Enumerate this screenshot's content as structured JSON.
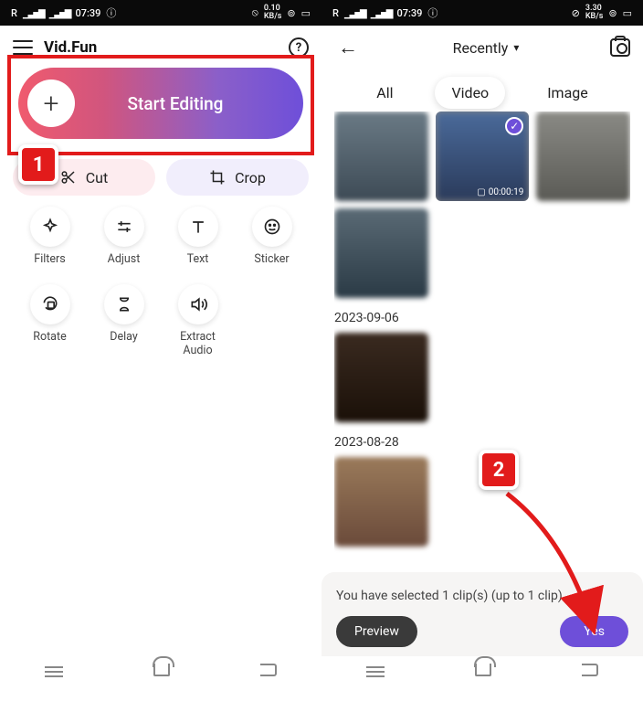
{
  "status": {
    "carrier": "R",
    "time": "07:39",
    "net_speed": "0.10",
    "net_unit": "KB/s",
    "battery": "100"
  },
  "appbar": {
    "title": "Vid.Fun"
  },
  "start": {
    "label": "Start Editing"
  },
  "pills": {
    "cut": "Cut",
    "crop": "Crop"
  },
  "tools": {
    "filters": "Filters",
    "adjust": "Adjust",
    "text": "Text",
    "sticker": "Sticker",
    "rotate": "Rotate",
    "delay": "Delay",
    "extract": "Extract\nAudio"
  },
  "picker": {
    "sort": "Recently",
    "tabs": {
      "all": "All",
      "video": "Video",
      "image": "Image"
    },
    "duration1": "00:00:19",
    "date1": "2023-09-06",
    "date2": "2023-08-28"
  },
  "sheet": {
    "text": "You have selected 1 clip(s) (up to 1 clip)",
    "preview": "Preview",
    "yes": "Yes"
  },
  "annot": {
    "b1": "1",
    "b2": "2"
  }
}
